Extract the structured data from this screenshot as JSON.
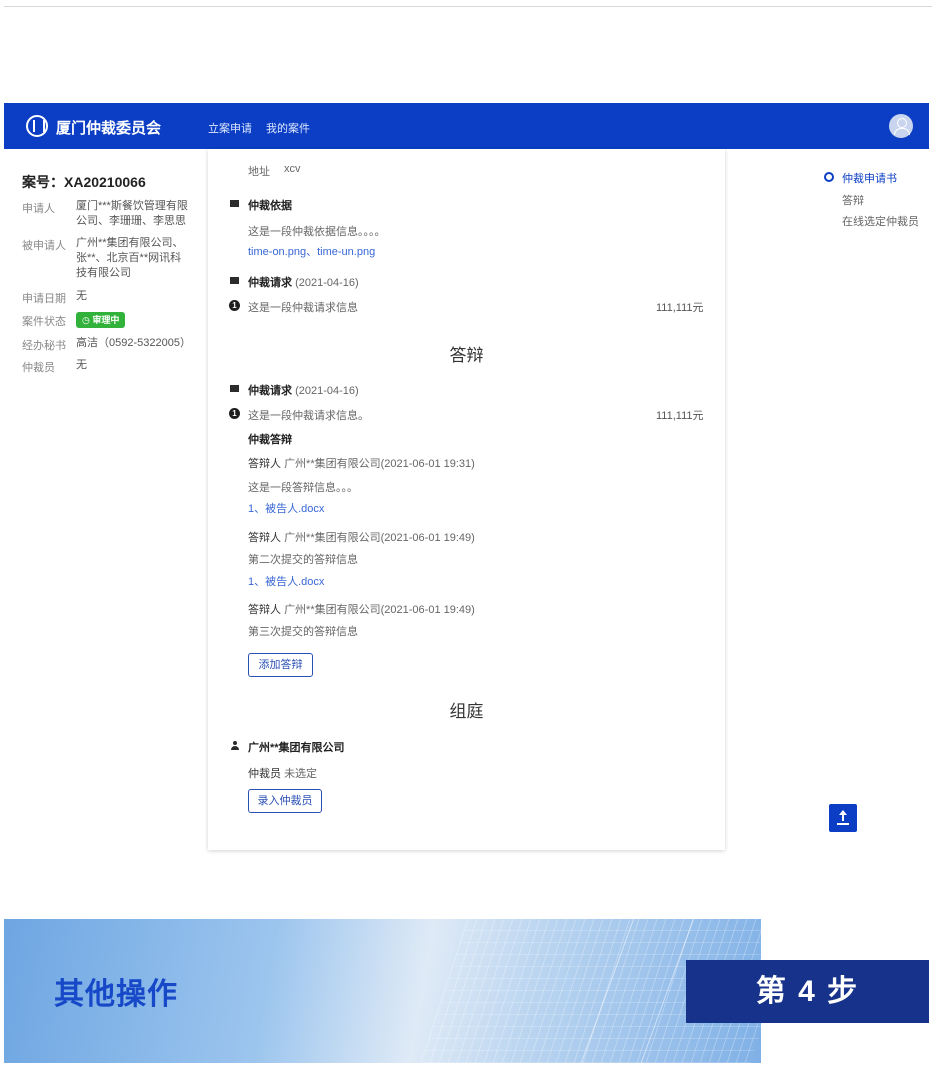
{
  "header": {
    "app_title": "厦门仲裁委员会",
    "nav": [
      "立案申请",
      "我的案件"
    ]
  },
  "case_info": {
    "case_no": "案号：XA20210066",
    "fields": [
      {
        "label": "申请人",
        "value": "厦门***斯餐饮管理有限公司、李珊珊、李思思"
      },
      {
        "label": "被申请人",
        "value": "广州**集团有限公司、张**、北京百**网讯科技有限公司"
      },
      {
        "label": "申请日期",
        "value": "无"
      },
      {
        "label": "案件状态",
        "value": "审理中"
      },
      {
        "label": "经办秘书",
        "value": "高洁（0592-5322005）"
      },
      {
        "label": "仲裁员",
        "value": "无"
      }
    ]
  },
  "application": {
    "address_label": "地址",
    "address_value": "xcv",
    "basis_title": "仲裁依据",
    "basis_text": "这是一段仲裁依据信息。。。。",
    "files": [
      "time-on.png",
      "time-un.png"
    ],
    "file_separator": "、",
    "request_title": "仲裁请求",
    "request_date": "(2021-04-16)",
    "request_item": "这是一段仲裁请求信息",
    "request_amount": "111,111元"
  },
  "defense": {
    "section_title": "答辩",
    "request_title": "仲裁请求",
    "request_date": "(2021-04-16)",
    "request_item": "这是一段仲裁请求信息。",
    "request_amount": "111,111元",
    "defense_title": "仲裁答辩",
    "entries": [
      {
        "label": "答辩人",
        "party": "广州**集团有限公司",
        "time": "(2021-06-01 19:31)",
        "text": "这是一段答辩信息。。。",
        "file": "1、被告人.docx"
      },
      {
        "label": "答辩人",
        "party": "广州**集团有限公司",
        "time": "(2021-06-01 19:49)",
        "text": "第二次提交的答辩信息",
        "file": "1、被告人.docx"
      },
      {
        "label": "答辩人",
        "party": "广州**集团有限公司",
        "time": "(2021-06-01 19:49)",
        "text": "第三次提交的答辩信息",
        "file": ""
      }
    ],
    "add_button": "添加答辩"
  },
  "tribunal": {
    "section_title": "组庭",
    "party": "广州**集团有限公司",
    "arbitrator_label": "仲裁员",
    "arbitrator_value": "未选定",
    "enter_button": "录入仲裁员"
  },
  "anchor_nav": [
    "仲裁申请书",
    "答辩",
    "在线选定仲裁员"
  ],
  "banner": {
    "title": "其他操作",
    "step": "第 4 步"
  },
  "colors": {
    "primary": "#0b3ec4",
    "status_green": "#32b13b",
    "step_bg": "#17328a"
  }
}
